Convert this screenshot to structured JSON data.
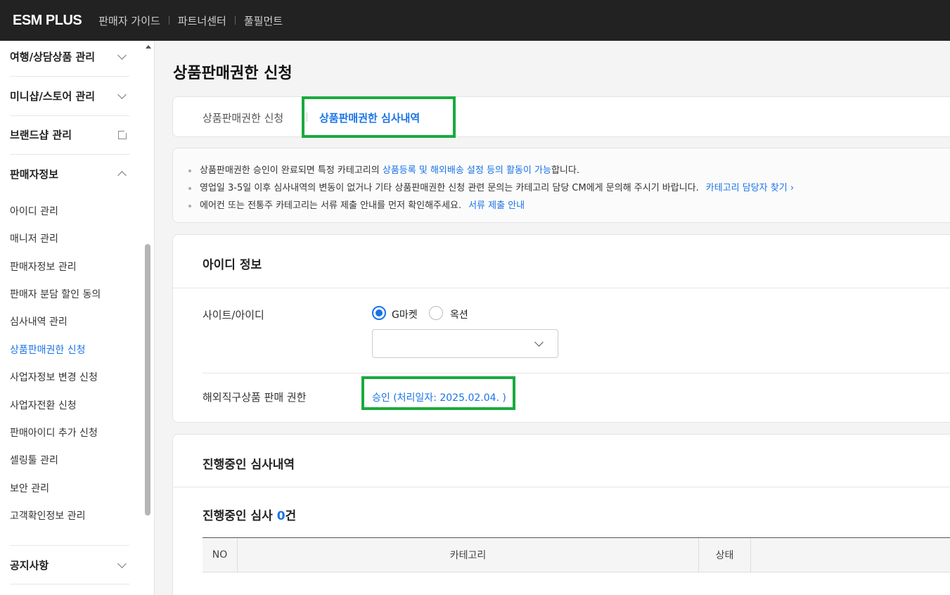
{
  "header": {
    "logo": "ESM PLUS",
    "nav": [
      "판매자 가이드",
      "파트너센터",
      "풀필먼트"
    ]
  },
  "sidebar": {
    "groups": [
      {
        "label": "여행/상담상품 관리"
      },
      {
        "label": "미니샵/스토어 관리"
      },
      {
        "label": "브랜드샵 관리"
      },
      {
        "label": "판매자정보"
      }
    ],
    "sub_items": [
      "아이디 관리",
      "매니저 관리",
      "판매자정보 관리",
      "판매자 분담 할인 동의",
      "심사내역 관리",
      "상품판매권한 신청",
      "사업자정보 변경 신청",
      "사업자전환 신청",
      "판매아이디 추가 신청",
      "셀링툴 관리",
      "보안 관리",
      "고객확인정보 관리"
    ],
    "active_sub": "상품판매권한 신청",
    "bottom_group": "공지사항"
  },
  "page": {
    "title": "상품판매권한 신청",
    "tabs": [
      {
        "label": "상품판매권한 신청",
        "active": false
      },
      {
        "label": "상품판매권한 심사내역",
        "active": true
      }
    ]
  },
  "notice": {
    "line1_pre": "상품판매권한 승인이 완료되면 특정 카테고리의 ",
    "line1_link": "상품등록 및 해외배송 설정 등의 활동이 가능",
    "line1_post": "합니다.",
    "line2_pre": "영업일 3-5일 이후 심사내역의 변동이 없거나 기타 상품판매권한 신청 관련 문의는 카테고리 담당 CM에게 문의해 주시기 바랍니다.",
    "line2_link": "카테고리 담당자 찾기 ›",
    "line3_pre": "에어컨 또는 전통주 카테고리는 서류 제출 안내를 먼저 확인해주세요.",
    "line3_link": "서류 제출 안내"
  },
  "id_info": {
    "title": "아이디 정보",
    "site_label": "사이트/아이디",
    "radio_gmarket": "G마켓",
    "radio_auction": "옥션",
    "selected_site": "G마켓",
    "id_select_value": "",
    "overseas_label": "해외직구상품 판매 권한",
    "overseas_value": "승인 (처리일자: 2025.02.04. )"
  },
  "review": {
    "title": "진행중인 심사내역",
    "count_prefix": "진행중인 심사 ",
    "count": "0",
    "count_suffix": "건",
    "columns": [
      "NO",
      "카테고리",
      "상태"
    ]
  },
  "colors": {
    "accent": "#1a73e8",
    "highlight": "#1aaa3e",
    "topbar": "#222222"
  }
}
